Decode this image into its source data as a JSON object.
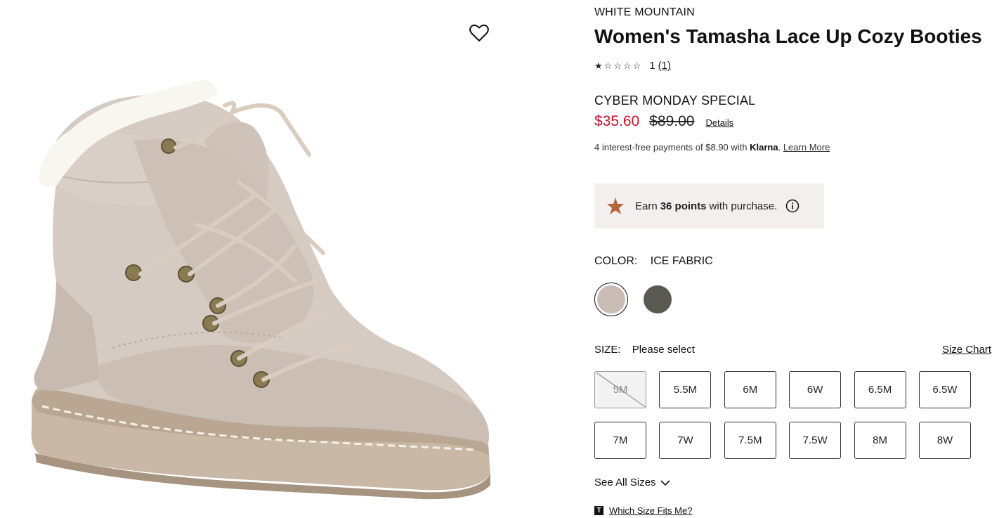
{
  "product": {
    "brand": "WHITE MOUNTAIN",
    "title": "Women's Tamasha Lace Up Cozy Booties",
    "rating": {
      "value": 1,
      "max": 5,
      "count_label": "1",
      "reviews_label": "(1)"
    },
    "promo_label": "CYBER MONDAY SPECIAL",
    "sale_price": "$35.60",
    "original_price": "$89.00",
    "details_link": "Details",
    "klarna": {
      "prefix": "4 interest-free payments of $8.90 with ",
      "brand": "Klarna",
      "suffix": ". ",
      "learn_more": "Learn More"
    },
    "points": {
      "prefix": "Earn",
      "value": "36 points",
      "suffix": "with purchase."
    }
  },
  "color": {
    "label": "COLOR:",
    "selected_name": "ICE FABRIC",
    "swatches": [
      {
        "name": "ICE FABRIC",
        "hex": "#c9bcb5",
        "selected": true
      },
      {
        "name": "olive",
        "hex": "#5b5a52",
        "selected": false
      }
    ]
  },
  "size": {
    "label": "SIZE:",
    "prompt": "Please select",
    "chart_link": "Size Chart",
    "options": [
      {
        "label": "5M",
        "available": false
      },
      {
        "label": "5.5M",
        "available": true
      },
      {
        "label": "6M",
        "available": true
      },
      {
        "label": "6W",
        "available": true
      },
      {
        "label": "6.5M",
        "available": true
      },
      {
        "label": "6.5W",
        "available": true
      },
      {
        "label": "7M",
        "available": true
      },
      {
        "label": "7W",
        "available": true
      },
      {
        "label": "7.5M",
        "available": true
      },
      {
        "label": "7.5W",
        "available": true
      },
      {
        "label": "8M",
        "available": true
      },
      {
        "label": "8W",
        "available": true
      }
    ],
    "see_all": "See All Sizes",
    "fits_icon": "T",
    "fits_link": "Which Size Fits Me?"
  },
  "icons": {
    "wishlist": "heart-outline-icon",
    "points": "star-icon",
    "info": "info-icon",
    "chevron": "chevron-down-icon",
    "fits": "true-fit-icon"
  },
  "colors": {
    "sale": "#d0102e",
    "points_bg": "#f3efee",
    "points_star": "#b5653a"
  }
}
